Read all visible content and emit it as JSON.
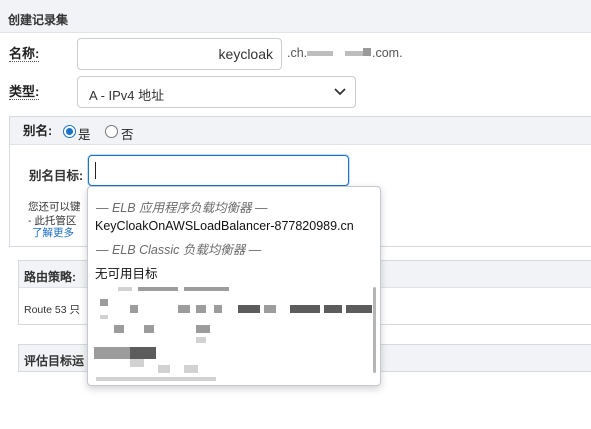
{
  "header": {
    "title": "创建记录集"
  },
  "form": {
    "name_label": "名称:",
    "name_value": "keycloak",
    "domain_prefix": ".ch.",
    "domain_suffix": ".com.",
    "type_label": "类型:",
    "type_value": "A - IPv4 地址"
  },
  "alias": {
    "label": "别名:",
    "yes_label": "是",
    "no_label": "否",
    "yes_selected": true,
    "target_label": "别名目标:",
    "target_value": "",
    "help_line1": "您还可以键",
    "help_line2": "- 此托管区",
    "learn_more": "了解更多"
  },
  "routing": {
    "title": "路由策略:",
    "body": "Route 53 只"
  },
  "eval": {
    "title": "评估目标运"
  },
  "dropdown": {
    "group_elb": "— ELB 应用程序负载均衡器 —",
    "elb_option": "KeyCloakOnAWSLoadBalancer-877820989.cn",
    "group_classic": "— ELB Classic 负载均衡器 —",
    "no_targets": "无可用目标"
  },
  "colors": {
    "accent": "#1a73c9",
    "header_bg": "#f1f3f6",
    "border": "#c9ced4"
  }
}
